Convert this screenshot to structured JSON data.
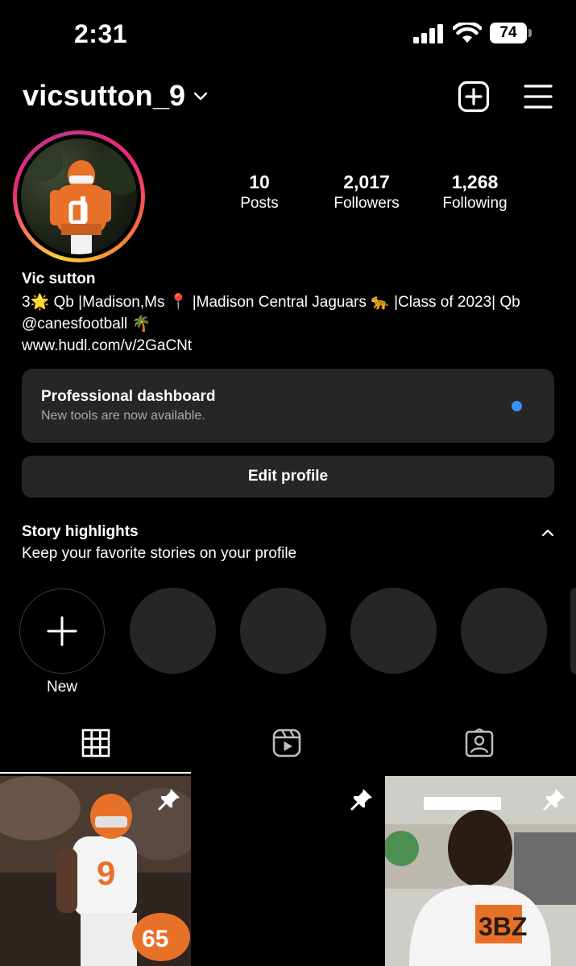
{
  "status_bar": {
    "time": "2:31",
    "battery": "74"
  },
  "header": {
    "username": "vicsutton_9"
  },
  "profile": {
    "stats": {
      "posts": {
        "count": "10",
        "label": "Posts"
      },
      "followers": {
        "count": "2,017",
        "label": "Followers"
      },
      "following": {
        "count": "1,268",
        "label": "Following"
      }
    },
    "full_name": "Vic sutton",
    "bio": "3🌟 Qb |Madison,Ms 📍 |Madison Central Jaguars 🐆 |Class of 2023| Qb @canesfootball 🌴",
    "link": "www.hudl.com/v/2GaCNt"
  },
  "dashboard": {
    "title": "Professional dashboard",
    "subtitle": "New tools are now available.",
    "dot_color": "#3e8ff7"
  },
  "edit_profile_label": "Edit profile",
  "highlights": {
    "title": "Story highlights",
    "subtitle": "Keep your favorite stories on your profile",
    "new_label": "New"
  },
  "tabs": [
    {
      "icon": "grid-icon",
      "active": true
    },
    {
      "icon": "reels-icon",
      "active": false
    },
    {
      "icon": "tagged-icon",
      "active": false
    }
  ],
  "posts": [
    {
      "pinned": true
    },
    {
      "pinned": true
    },
    {
      "pinned": true
    }
  ],
  "colors": {
    "background": "#000000",
    "card": "#262626",
    "accent_blue": "#3e8ff7"
  }
}
